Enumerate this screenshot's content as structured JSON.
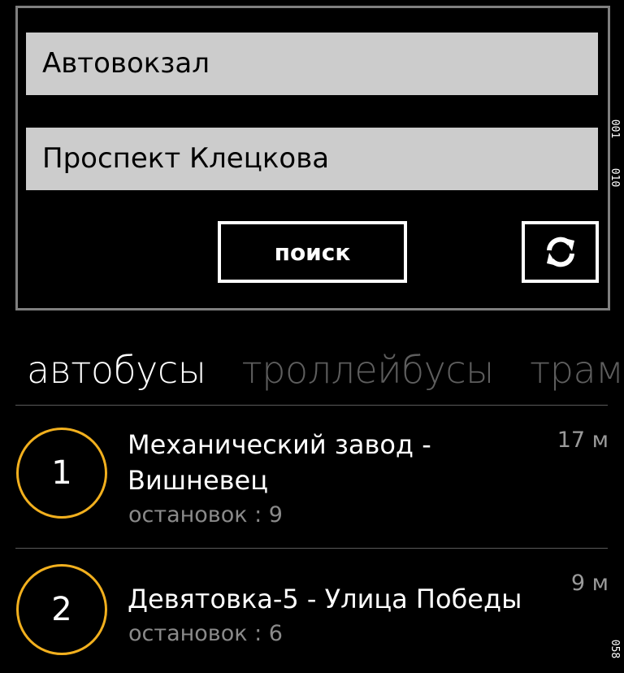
{
  "search": {
    "from_value": "Автовокзал",
    "to_value": "Проспект Клецкова",
    "search_label": "поиск",
    "swap_icon": "refresh-icon"
  },
  "side_tags": [
    "001",
    "010",
    "058"
  ],
  "tabs": [
    {
      "label": "автобусы",
      "active": true
    },
    {
      "label": "троллейбусы",
      "active": false
    },
    {
      "label": "трамв",
      "active": false
    }
  ],
  "routes": [
    {
      "number": "1",
      "name_line1": "Механический завод -",
      "name_line2": "Вишневец",
      "stops": "остановок : 9",
      "time": "17 м"
    },
    {
      "number": "2",
      "name_line1": "Девятовка-5 - Улица Победы",
      "stops": "остановок : 6",
      "time": "9 м"
    }
  ],
  "colors": {
    "accent": "#f2b01e",
    "field_bg": "#cccccc",
    "panel_border": "#7f7f7f"
  }
}
